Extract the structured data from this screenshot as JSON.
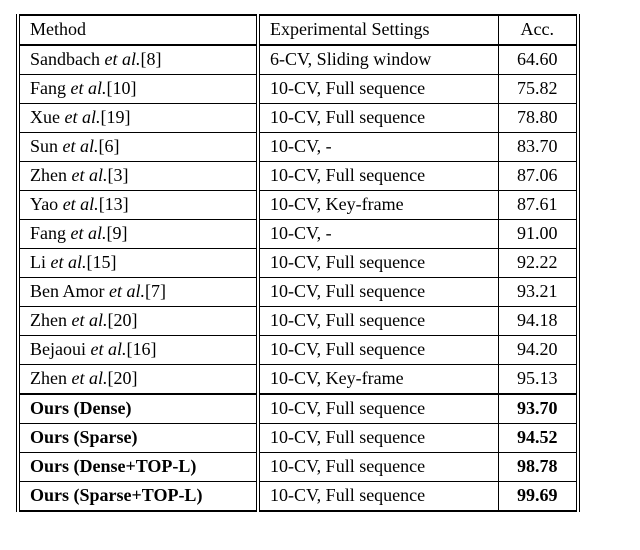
{
  "headers": {
    "method": "Method",
    "settings": "Experimental Settings",
    "acc": "Acc."
  },
  "rows": [
    {
      "author": "Sandbach",
      "suffix": "et al.",
      "ref": "[8]",
      "settings": "6-CV, Sliding window",
      "acc": "64.60",
      "bold": false
    },
    {
      "author": "Fang",
      "suffix": "et al.",
      "ref": "[10]",
      "settings": "10-CV, Full sequence",
      "acc": "75.82",
      "bold": false
    },
    {
      "author": "Xue",
      "suffix": "et al.",
      "ref": "[19]",
      "settings": "10-CV, Full sequence",
      "acc": "78.80",
      "bold": false
    },
    {
      "author": "Sun",
      "suffix": "et al.",
      "ref": "[6]",
      "settings": "10-CV, -",
      "acc": "83.70",
      "bold": false
    },
    {
      "author": "Zhen",
      "suffix": "et al.",
      "ref": "[3]",
      "settings": "10-CV, Full sequence",
      "acc": "87.06",
      "bold": false
    },
    {
      "author": "Yao",
      "suffix": "et al.",
      "ref": "[13]",
      "settings": "10-CV, Key-frame",
      "acc": "87.61",
      "bold": false
    },
    {
      "author": "Fang",
      "suffix": "et al.",
      "ref": "[9]",
      "settings": "10-CV, -",
      "acc": "91.00",
      "bold": false
    },
    {
      "author": "Li",
      "suffix": "et al.",
      "ref": "[15]",
      "settings": "10-CV, Full sequence",
      "acc": "92.22",
      "bold": false
    },
    {
      "author": "Ben Amor",
      "suffix": "et al.",
      "ref": "[7]",
      "settings": "10-CV, Full sequence",
      "acc": "93.21",
      "bold": false
    },
    {
      "author": "Zhen",
      "suffix": "et al.",
      "ref": "[20]",
      "settings": "10-CV, Full sequence",
      "acc": "94.18",
      "bold": false
    },
    {
      "author": "Bejaoui",
      "suffix": "et al.",
      "ref": "[16]",
      "settings": "10-CV, Full sequence",
      "acc": "94.20",
      "bold": false
    },
    {
      "author": "Zhen",
      "suffix": "et al.",
      "ref": "[20]",
      "settings": "10-CV, Key-frame",
      "acc": "95.13",
      "bold": false
    }
  ],
  "ours": [
    {
      "label": "Ours (Dense)",
      "settings": "10-CV, Full sequence",
      "acc": "93.70"
    },
    {
      "label": "Ours (Sparse)",
      "settings": "10-CV, Full sequence",
      "acc": "94.52"
    },
    {
      "label": "Ours (Dense+TOP-L)",
      "settings": "10-CV, Full sequence",
      "acc": "98.78"
    },
    {
      "label": "Ours (Sparse+TOP-L)",
      "settings": "10-CV, Full sequence",
      "acc": "99.69"
    }
  ]
}
